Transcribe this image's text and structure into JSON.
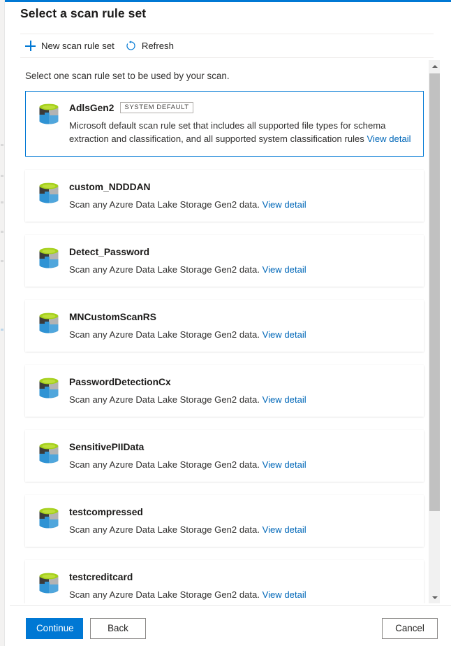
{
  "blade": {
    "title": "Select a scan rule set",
    "instruction": "Select one scan rule set to be used by your scan."
  },
  "commandbar": {
    "new_label": "New scan rule set",
    "refresh_label": "Refresh",
    "new_icon": "plus-icon",
    "refresh_icon": "refresh-icon",
    "accent_color": "#0078d4"
  },
  "rule_sets": [
    {
      "name": "AdlsGen2",
      "badge": "SYSTEM DEFAULT",
      "description": "Microsoft default scan rule set that includes all supported file types for schema extraction and classification, and all supported system classification rules",
      "link": "View detail",
      "icon": "adls-gen2-icon",
      "selected": true
    },
    {
      "name": "custom_NDDDAN",
      "badge": "",
      "description": "Scan any Azure Data Lake Storage Gen2 data.",
      "link": "View detail",
      "icon": "adls-gen2-icon",
      "selected": false
    },
    {
      "name": "Detect_Password",
      "badge": "",
      "description": "Scan any Azure Data Lake Storage Gen2 data.",
      "link": "View detail",
      "icon": "adls-gen2-icon",
      "selected": false
    },
    {
      "name": "MNCustomScanRS",
      "badge": "",
      "description": "Scan any Azure Data Lake Storage Gen2 data.",
      "link": "View detail",
      "icon": "adls-gen2-icon",
      "selected": false
    },
    {
      "name": "PasswordDetectionCx",
      "badge": "",
      "description": "Scan any Azure Data Lake Storage Gen2 data.",
      "link": "View detail",
      "icon": "adls-gen2-icon",
      "selected": false
    },
    {
      "name": "SensitivePIIData",
      "badge": "",
      "description": "Scan any Azure Data Lake Storage Gen2 data.",
      "link": "View detail",
      "icon": "adls-gen2-icon",
      "selected": false
    },
    {
      "name": "testcompressed",
      "badge": "",
      "description": "Scan any Azure Data Lake Storage Gen2 data.",
      "link": "View detail",
      "icon": "adls-gen2-icon",
      "selected": false
    },
    {
      "name": "testcreditcard",
      "badge": "",
      "description": "Scan any Azure Data Lake Storage Gen2 data.",
      "link": "View detail",
      "icon": "adls-gen2-icon",
      "selected": false
    }
  ],
  "scrollbar": {
    "up_icon": "caret-up-icon",
    "down_icon": "caret-down-icon"
  },
  "footer": {
    "continue_label": "Continue",
    "back_label": "Back",
    "cancel_label": "Cancel",
    "primary_color": "#0078d4"
  }
}
